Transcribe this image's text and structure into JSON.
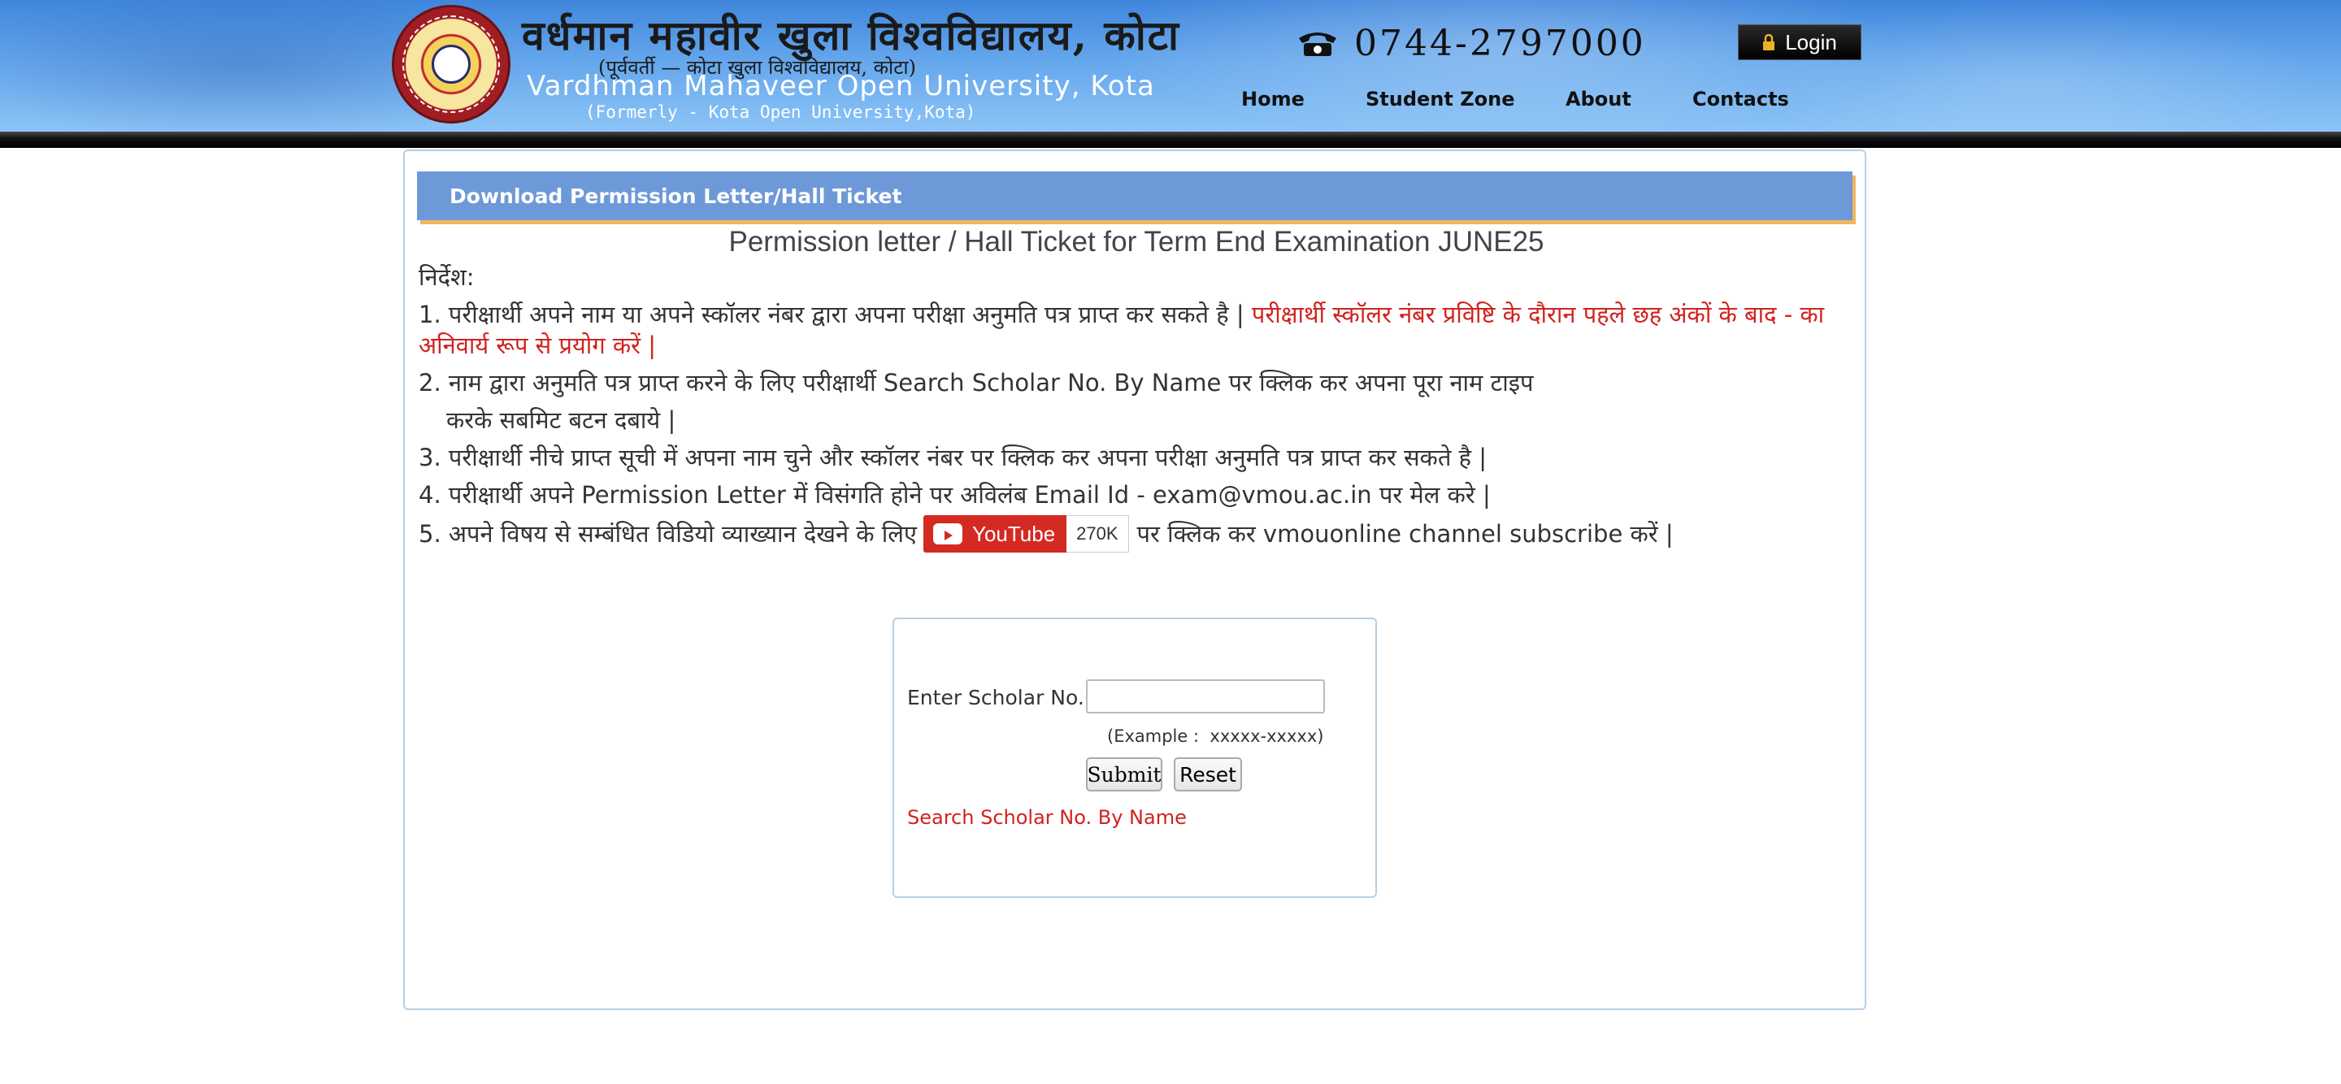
{
  "header": {
    "university_hindi": "वर्धमान महावीर खुला विश्वविद्यालय, कोटा",
    "university_hindi_sub": "(पूर्ववर्ती — कोटा खुला विश्वविद्यालय, कोटा)",
    "university_english": "Vardhman Mahaveer Open University, Kota",
    "university_english_sub": "(Formerly - Kota Open University,Kota)",
    "phone_icon": "telephone-icon",
    "phone": "0744-2797000",
    "login_label": "Login",
    "login_icon": "lock-icon",
    "nav": [
      {
        "label": "Home"
      },
      {
        "label": "Student Zone"
      },
      {
        "label": "About"
      },
      {
        "label": "Contacts"
      }
    ]
  },
  "main": {
    "section_title": "Download Permission Letter/Hall Ticket",
    "page_title": "Permission letter / Hall Ticket for Term End Examination JUNE25",
    "instructions_heading": "निर्देश:",
    "instruction1_black": "1. परीक्षार्थी अपने नाम या अपने स्कॉलर नंबर द्वारा अपना परीक्षा अनुमति पत्र प्राप्त कर सकते है |",
    "instruction1_red": "परीक्षार्थी स्कॉलर नंबर प्रविष्टि के दौरान पहले छह अंकों के बाद - का अनिवार्य रूप से प्रयोग करें |",
    "instruction2_line1": "2. नाम द्वारा अनुमति पत्र प्राप्त करने के लिए परीक्षार्थी Search Scholar No. By Name पर क्लिक कर अपना पूरा नाम टाइप",
    "instruction2_line2": "करके सबमिट बटन दबाये |",
    "instruction3": "3. परीक्षार्थी नीचे प्राप्त सूची में अपना नाम चुने और स्कॉलर नंबर पर क्लिक कर अपना परीक्षा अनुमति पत्र प्राप्त कर सकते है |",
    "instruction4": "4. परीक्षार्थी अपने Permission Letter में विसंगति होने पर अविलंब Email Id - exam@vmou.ac.in पर मेल करे |",
    "instruction5_before": "5. अपने विषय से सम्बंधित विडियो व्याख्यान देखने के लिए",
    "youtube_label": "YouTube",
    "youtube_count": "270K",
    "instruction5_after": "पर क्लिक कर vmouonline channel subscribe करें |"
  },
  "form": {
    "scholar_label": "Enter Scholar No.:",
    "scholar_value": "",
    "example": "(Example :  xxxxx-xxxxx)",
    "submit_label": "Submit",
    "reset_label": "Reset",
    "search_link": "Search Scholar No. By Name"
  },
  "colors": {
    "header_blue": "#5a9ee8",
    "section_header": "#6e99d8",
    "accent_orange": "#f0b75e",
    "alert_red": "#d0231f",
    "youtube_red": "#d32a22"
  }
}
